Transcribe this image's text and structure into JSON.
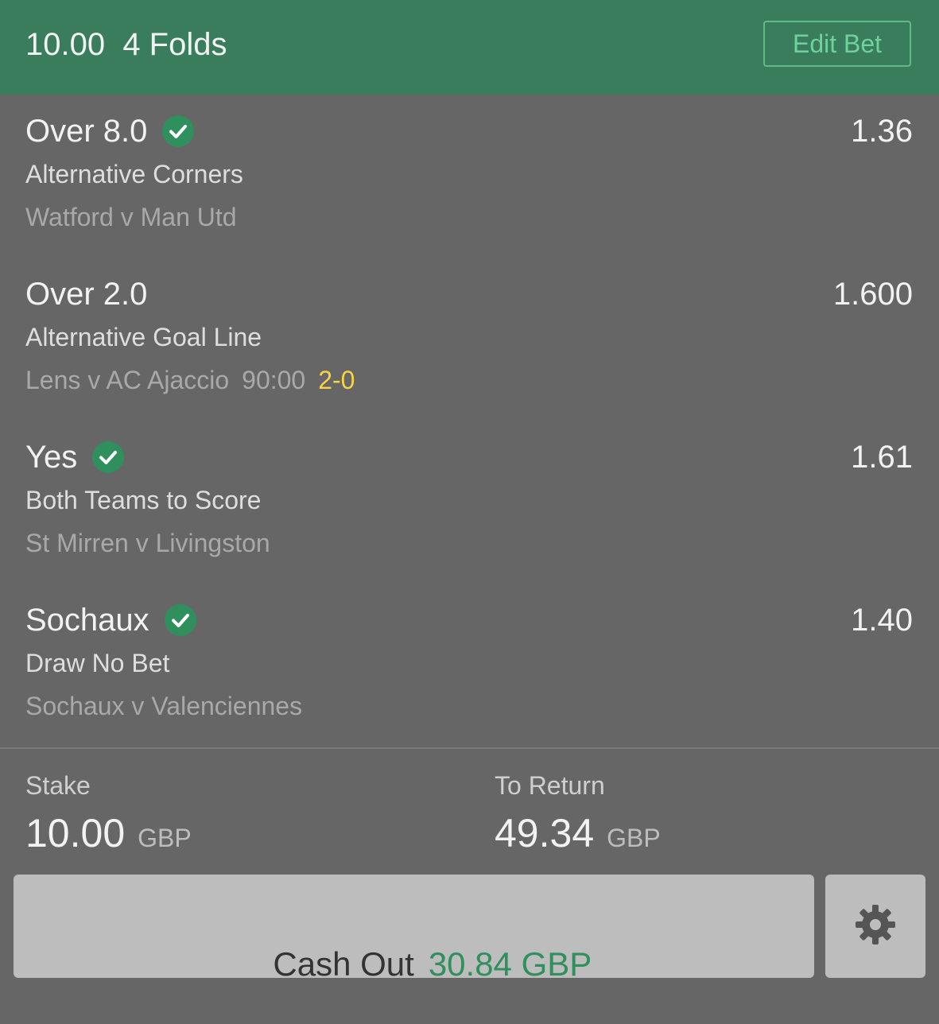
{
  "header": {
    "title": "10.00  4 Folds",
    "edit_label": "Edit Bet"
  },
  "selections": [
    {
      "name": "Over 8.0",
      "settled_icon": "check-circle-icon",
      "odds": "1.36",
      "market": "Alternative Corners",
      "event": "Watford v Man Utd",
      "time": "",
      "score": ""
    },
    {
      "name": "Over 2.0",
      "settled_icon": "",
      "odds": "1.600",
      "market": "Alternative Goal Line",
      "event": "Lens v AC Ajaccio",
      "time": "90:00",
      "score": "2-0"
    },
    {
      "name": "Yes",
      "settled_icon": "check-circle-icon",
      "odds": "1.61",
      "market": "Both Teams to Score",
      "event": "St Mirren v Livingston",
      "time": "",
      "score": ""
    },
    {
      "name": "Sochaux",
      "settled_icon": "check-circle-icon",
      "odds": "1.40",
      "market": "Draw No Bet",
      "event": "Sochaux v Valenciennes",
      "time": "",
      "score": ""
    }
  ],
  "summary": {
    "stake_label": "Stake",
    "stake_amount": "10.00",
    "stake_currency": "GBP",
    "return_label": "To Return",
    "return_amount": "49.34",
    "return_currency": "GBP"
  },
  "cashout": {
    "label": "Cash Out",
    "amount": "30.84 GBP"
  },
  "colors": {
    "header_bg": "#3a7d5d",
    "body_bg": "#666666",
    "accent_green": "#6fd29c",
    "score_yellow": "#f5d445",
    "check_green": "#2f8f5d"
  },
  "icons": {
    "settings": "gear-icon",
    "settled": "check-circle-icon"
  }
}
